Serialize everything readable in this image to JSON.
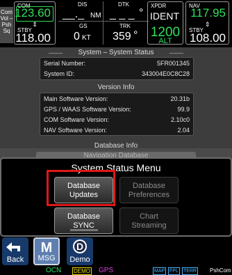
{
  "top": {
    "knob_label": "Com Vol – Psh Sq",
    "com": {
      "label": "COM",
      "active": "123.60",
      "stby_label": "STBY",
      "stby": "118.00"
    },
    "nav": {
      "label": "NAV",
      "active": "117.95",
      "stby_label": "STBY",
      "stby": "108.00"
    },
    "dis": {
      "label": "DIS",
      "value": "__._",
      "unit": "NM"
    },
    "dtk": {
      "label": "DTK",
      "value": "_ _ _",
      "unit": "°"
    },
    "gs": {
      "label": "GS",
      "value": "0",
      "unit": "KT"
    },
    "trk": {
      "label": "TRK",
      "value": "359",
      "unit": "°"
    },
    "xpdr": {
      "label": "XPDR",
      "ident": "IDENT",
      "code": "1200",
      "mode": "ALT"
    },
    "swap_glyph": "⇕"
  },
  "status": {
    "heading": "System – System Status",
    "serial_label": "Serial Number:",
    "serial_value": "5FR001345",
    "sysid_label": "System ID:",
    "sysid_value": "343004E0C8C28",
    "version_heading": "Version Info",
    "versions": [
      {
        "label": "Main Software Version:",
        "value": "20.31b"
      },
      {
        "label": "GPS / WAAS Software Version:",
        "value": "99.9"
      },
      {
        "label": "COM Software Version:",
        "value": "2.10c0"
      },
      {
        "label": "NAV Software Version:",
        "value": "2.04"
      }
    ],
    "db_heading": "Database Info",
    "nav_db": "Navigation Database"
  },
  "menu": {
    "title": "System Status Menu",
    "buttons": [
      {
        "line1": "Database",
        "line2": "Updates",
        "enabled": true
      },
      {
        "line1": "Database",
        "line2": "Preferences",
        "enabled": false
      },
      {
        "line1": "Database",
        "line2": "SYNC",
        "enabled": true
      },
      {
        "line1": "Chart",
        "line2": "Streaming",
        "enabled": false
      }
    ]
  },
  "bottom": {
    "back": "Back",
    "msg": "MSG",
    "demo": "Demo",
    "msg_letter": "M",
    "demo_letter": "D"
  },
  "statusbar": {
    "ocn": "OCN",
    "demo": "DEMO",
    "gps": "GPS",
    "map": "MAP",
    "fpl": "FPL",
    "terr": "TERR",
    "psh": "PshCom"
  },
  "colors": {
    "green": "#2fe05a",
    "cyan": "#46b6ff",
    "magenta": "#e040e0",
    "yellow": "#e6d600",
    "highlight": "#e11717"
  }
}
